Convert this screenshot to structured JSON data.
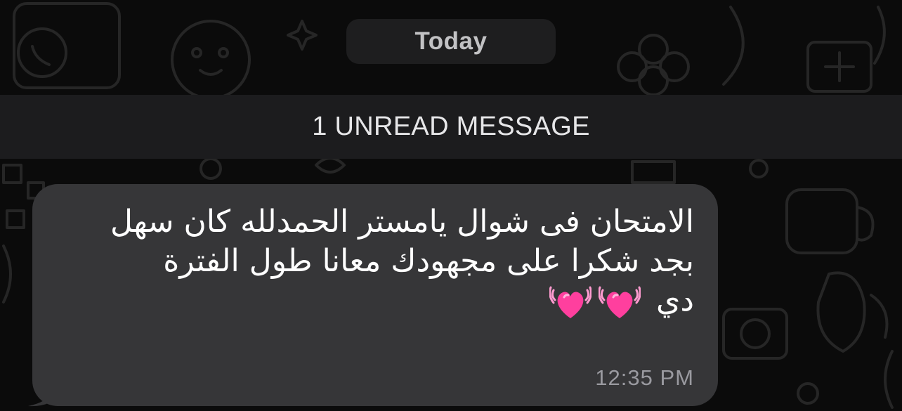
{
  "chat": {
    "date_label": "Today",
    "unread_label": "1 UNREAD MESSAGE"
  },
  "message": {
    "lines": [
      "الامتحان فى شوال يامستر الحمدلله كان سهل",
      "بجد شكرا على مجهودك معانا طول الفترة",
      "دي"
    ],
    "emoji": "heart-with-ribbons-icon x2",
    "time": "12:35 PM"
  },
  "colors": {
    "background": "#0b0b0b",
    "doodle": "#262626",
    "bubble": "#363638",
    "heart": "#ff3f9e"
  }
}
